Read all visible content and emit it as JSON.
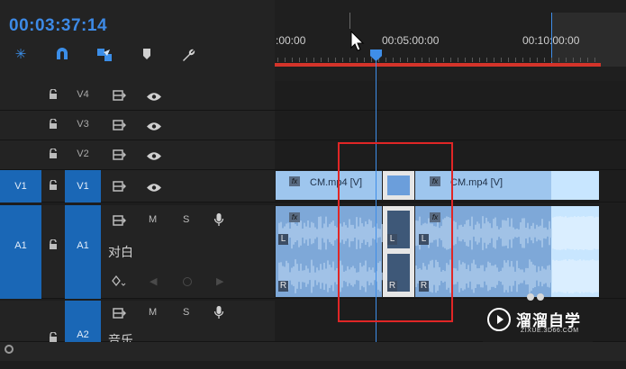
{
  "header": {
    "timecode": "00:03:37:14",
    "tools": [
      {
        "name": "snap-insert-icon"
      },
      {
        "name": "magnet-icon"
      },
      {
        "name": "linked-selection-icon"
      },
      {
        "name": "marker-icon"
      },
      {
        "name": "wrench-icon"
      }
    ]
  },
  "ruler": {
    "labels": [
      ":00:00",
      "00:05:00:00",
      "00:10:00:00"
    ]
  },
  "tracks": {
    "video": [
      {
        "src": "",
        "name": "V4"
      },
      {
        "src": "",
        "name": "V3"
      },
      {
        "src": "",
        "name": "V2"
      },
      {
        "src": "V1",
        "name": "V1"
      }
    ],
    "audio": [
      {
        "src": "A1",
        "name": "A1",
        "sub_label": "对白"
      },
      {
        "src": "",
        "name": "A2",
        "sub_label": "音乐"
      }
    ],
    "audio_buttons": {
      "mute": "M",
      "solo": "S"
    }
  },
  "clips": {
    "v1_left": "CM.mp4 [V]",
    "v1_right": "CM.mp4 [V]",
    "fx": "fx",
    "channel_l": "L",
    "channel_r": "R"
  },
  "watermark": {
    "title": "溜溜自学",
    "url": "ZIXUE.3D66.COM"
  },
  "colors": {
    "accent": "#3b8ee8",
    "clip_video": "#9ec6ee",
    "clip_audio": "#7ea8d8",
    "work_area": "#d4342a",
    "selection_box": "#e02626"
  }
}
